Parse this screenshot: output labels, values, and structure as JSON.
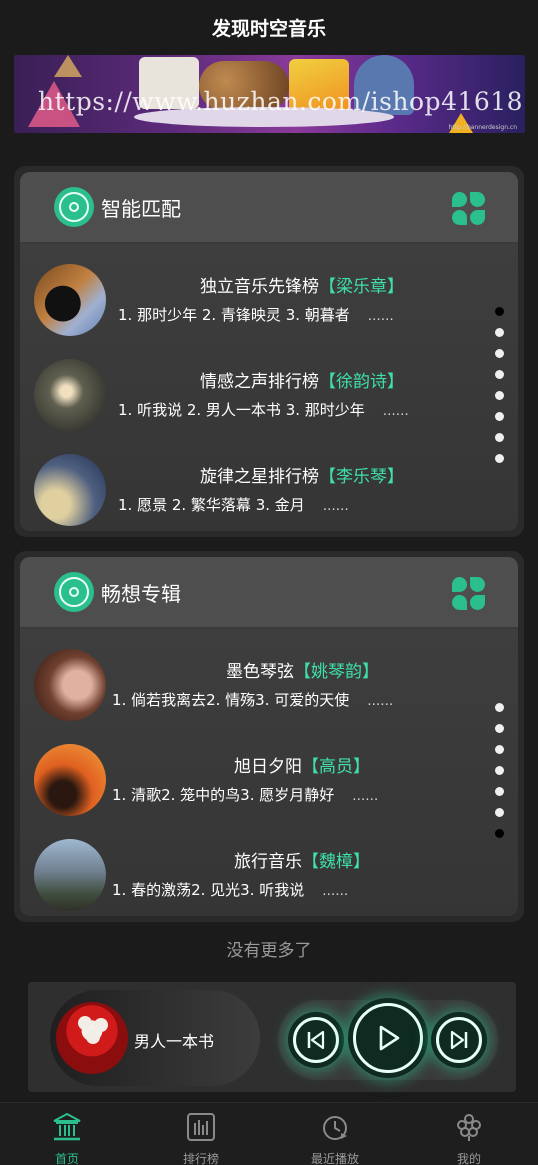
{
  "header": {
    "title": "发现时空音乐"
  },
  "banner": {
    "url_text": "https://www.huzhan.com/ishop41618",
    "credit": "http://bannerdesign.cn"
  },
  "sections": [
    {
      "title": "智能匹配",
      "icon": "disc-icon",
      "action_icon": "clover-icon",
      "items": [
        {
          "title": "独立音乐先锋榜",
          "singer": "【梁乐章】",
          "songs": "1. 那时少年 2. 青锋映灵 3. 朝暮者",
          "more": "……"
        },
        {
          "title": "情感之声排行榜",
          "singer": "【徐韵诗】",
          "songs": "1. 听我说 2. 男人一本书 3. 那时少年",
          "more": "……"
        },
        {
          "title": "旋律之星排行榜",
          "singer": "【李乐琴】",
          "songs": "1. 愿景 2. 繁华落幕 3. 金月",
          "more": "……"
        }
      ],
      "pager": {
        "count": 8,
        "active": 0
      }
    },
    {
      "title": "畅想专辑",
      "icon": "disc-icon",
      "action_icon": "clover-icon",
      "items": [
        {
          "title": "墨色琴弦",
          "singer": "【姚琴韵】",
          "songs": "1. 倘若我离去2. 情殇3. 可爱的天使",
          "more": "……"
        },
        {
          "title": "旭日夕阳",
          "singer": "【高员】",
          "songs": "1. 清歌2. 笼中的鸟3. 愿岁月静好",
          "more": "……"
        },
        {
          "title": "旅行音乐",
          "singer": "【魏樟】",
          "songs": "1. 春的激荡2. 见光3. 听我说",
          "more": "……"
        }
      ],
      "pager": {
        "count": 7,
        "active": 6
      }
    }
  ],
  "footer_note": "没有更多了",
  "player": {
    "song": "男人一本书",
    "controls": [
      "previous-icon",
      "play-icon",
      "next-icon"
    ]
  },
  "tabs": [
    {
      "label": "首页",
      "icon": "temple-icon",
      "active": true
    },
    {
      "label": "排行榜",
      "icon": "chart-bars-icon",
      "active": false
    },
    {
      "label": "最近播放",
      "icon": "clock-play-icon",
      "active": false
    },
    {
      "label": "我的",
      "icon": "flower-user-icon",
      "active": false
    }
  ],
  "colors": {
    "accent": "#2bbf8d",
    "singer": "#3ee0a8",
    "background": "#1b1b1b"
  }
}
